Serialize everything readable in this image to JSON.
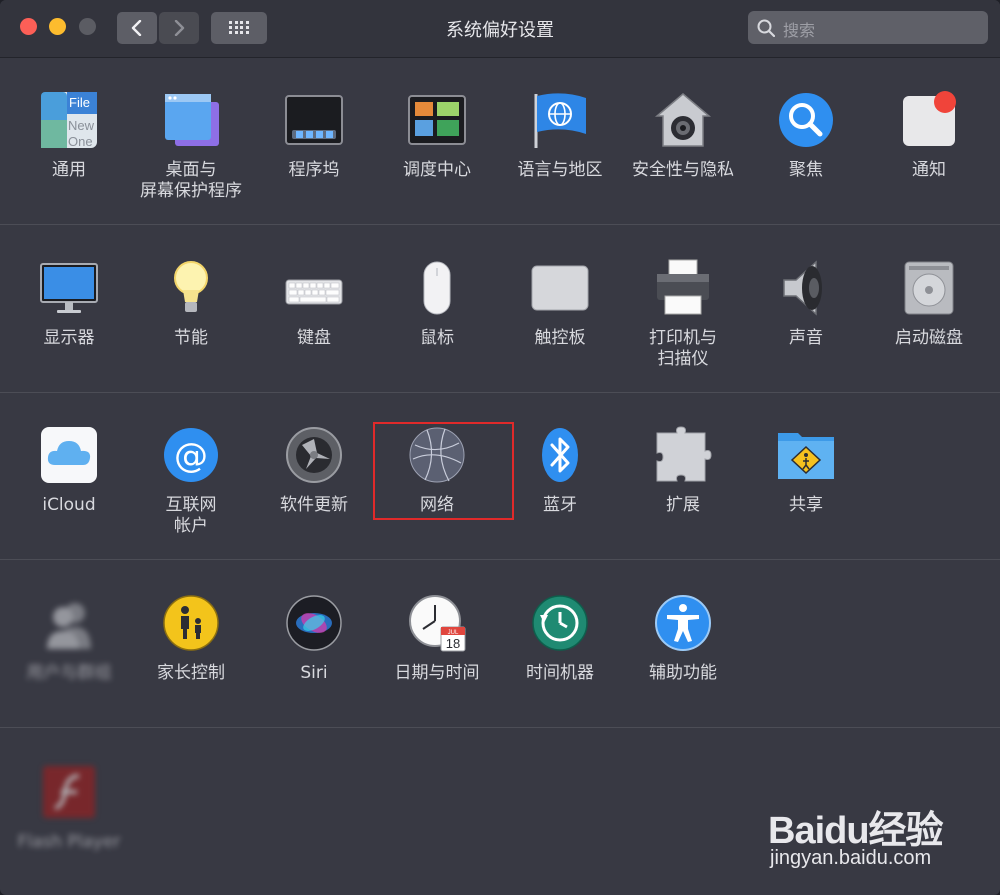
{
  "window": {
    "title": "系统偏好设置",
    "search_placeholder": "搜索"
  },
  "rows": [
    {
      "items": [
        {
          "label": "通用",
          "icon": "general-icon"
        },
        {
          "label": "桌面与\n屏幕保护程序",
          "icon": "desktop-screensaver-icon"
        },
        {
          "label": "程序坞",
          "icon": "dock-icon"
        },
        {
          "label": "调度中心",
          "icon": "mission-control-icon"
        },
        {
          "label": "语言与地区",
          "icon": "language-region-icon"
        },
        {
          "label": "安全性与隐私",
          "icon": "security-privacy-icon"
        },
        {
          "label": "聚焦",
          "icon": "spotlight-icon"
        },
        {
          "label": "通知",
          "icon": "notifications-icon"
        }
      ]
    },
    {
      "items": [
        {
          "label": "显示器",
          "icon": "displays-icon"
        },
        {
          "label": "节能",
          "icon": "energy-saver-icon"
        },
        {
          "label": "键盘",
          "icon": "keyboard-icon"
        },
        {
          "label": "鼠标",
          "icon": "mouse-icon"
        },
        {
          "label": "触控板",
          "icon": "trackpad-icon"
        },
        {
          "label": "打印机与\n扫描仪",
          "icon": "printers-scanners-icon"
        },
        {
          "label": "声音",
          "icon": "sound-icon"
        },
        {
          "label": "启动磁盘",
          "icon": "startup-disk-icon"
        }
      ]
    },
    {
      "items": [
        {
          "label": "iCloud",
          "icon": "icloud-icon"
        },
        {
          "label": "互联网\n帐户",
          "icon": "internet-accounts-icon"
        },
        {
          "label": "软件更新",
          "icon": "software-update-icon"
        },
        {
          "label": "网络",
          "icon": "network-icon"
        },
        {
          "label": "蓝牙",
          "icon": "bluetooth-icon"
        },
        {
          "label": "扩展",
          "icon": "extensions-icon"
        },
        {
          "label": "共享",
          "icon": "sharing-icon"
        }
      ]
    },
    {
      "items": [
        {
          "label": "用户与群组",
          "icon": "users-groups-icon"
        },
        {
          "label": "家长控制",
          "icon": "parental-controls-icon"
        },
        {
          "label": "Siri",
          "icon": "siri-icon"
        },
        {
          "label": "日期与时间",
          "icon": "date-time-icon"
        },
        {
          "label": "时间机器",
          "icon": "time-machine-icon"
        },
        {
          "label": "辅助功能",
          "icon": "accessibility-icon"
        }
      ]
    },
    {
      "items": [
        {
          "label": "Flash Player",
          "icon": "flash-player-icon"
        }
      ]
    }
  ],
  "date_icon": {
    "month": "JUL",
    "day": "18"
  },
  "general_icon": {
    "text_top": "File",
    "text_mid": "New",
    "text_bot": "One"
  },
  "watermark": {
    "brand": "Baidu经验",
    "url": "jingyan.baidu.com"
  },
  "colors": {
    "window_bg": "#383943",
    "titlebar": "#33343d",
    "highlight": "#e02a2a",
    "close": "#fc5f57",
    "minimize": "#fdbc2e"
  }
}
